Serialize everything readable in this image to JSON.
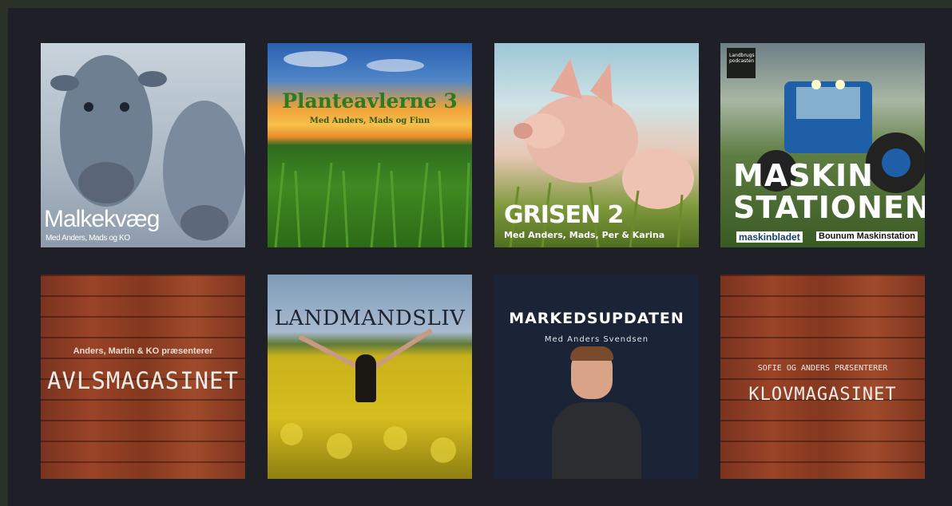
{
  "podcasts": [
    {
      "title": "Malkekvæg",
      "subtitle": "Med Anders, Mads og KO"
    },
    {
      "title": "Planteavlerne 3",
      "subtitle": "Med Anders, Mads og Finn"
    },
    {
      "title": "GRISEN 2",
      "subtitle": "Med Anders, Mads, Per & Karina"
    },
    {
      "badge": "Landbrugs podcasten",
      "title_line1": "MASKIN",
      "title_line2": "STATIONEN",
      "footer_left": "maskinbladet",
      "footer_right": "Bounum Maskinstation"
    },
    {
      "subtitle": "Anders, Martin & KO præsenterer",
      "title": "AVLSMAGASINET"
    },
    {
      "title": "LANDMANDSLIV"
    },
    {
      "title": "MARKEDSUPDATEN",
      "subtitle": "Med Anders Svendsen"
    },
    {
      "subtitle": "SOFIE OG ANDERS PRÆSENTERER",
      "title": "KLOVMAGASINET"
    }
  ]
}
